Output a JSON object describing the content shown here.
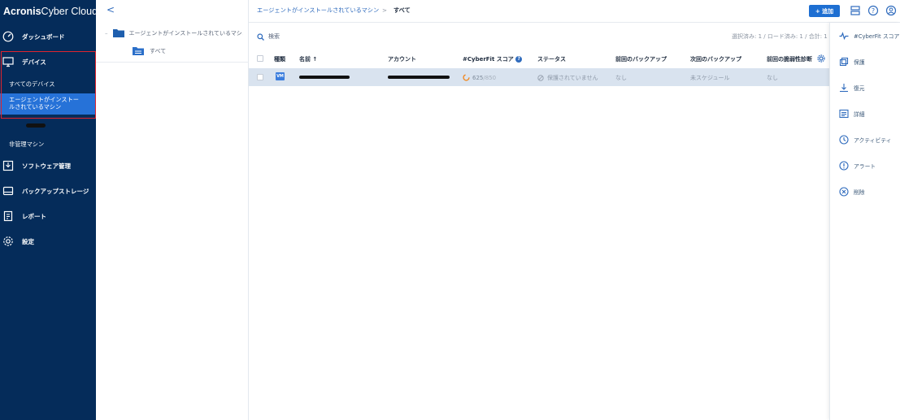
{
  "brand": {
    "name_bold": "Acronis",
    "name_rest": " Cyber Cloud"
  },
  "sidebar": {
    "items": [
      {
        "label": "ダッシュボード",
        "icon": "dashboard-icon"
      },
      {
        "label": "デバイス",
        "icon": "monitor-icon"
      },
      {
        "label": "ソフトウェア管理",
        "icon": "software-icon"
      },
      {
        "label": "バックアップストレージ",
        "icon": "storage-icon"
      },
      {
        "label": "レポート",
        "icon": "report-icon"
      },
      {
        "label": "設定",
        "icon": "gear-icon"
      }
    ],
    "sub_items": [
      {
        "label": "すべてのデバイス"
      },
      {
        "label_line1": "エージェントがインストー",
        "label_line2": "ルされているマシン"
      },
      {
        "label": "非管理マシン"
      }
    ]
  },
  "tree": {
    "back_glyph": "<",
    "root_label": "エージェントがインストールされているマシン",
    "child_label": "すべて"
  },
  "breadcrumb": {
    "parent": "エージェントがインストールされているマシン",
    "separator": ">",
    "current": "すべて"
  },
  "toolbar": {
    "add_label": "+ 追加"
  },
  "search": {
    "placeholder": "検索"
  },
  "count_text": "選択済み: 1 / ロード済み: 1 / 合計: 1",
  "table": {
    "columns": [
      "種類",
      "名前 ↑",
      "アカウント",
      "#CyberFit スコア",
      "ステータス",
      "前回のバックアップ",
      "次回のバックアップ",
      "前回の脆弱性診断"
    ],
    "row": {
      "type_badge": "VM",
      "score": "625",
      "score_max": "/850",
      "status": "保護されていません",
      "last_backup": "なし",
      "next_backup": "未スケジュール",
      "last_scan": "なし"
    }
  },
  "actions": [
    {
      "label": "#CyberFit スコア",
      "icon": "pulse-icon"
    },
    {
      "label": "保護",
      "icon": "protect-icon"
    },
    {
      "label": "復元",
      "icon": "recover-icon"
    },
    {
      "label": "詳細",
      "icon": "details-icon"
    },
    {
      "label": "アクティビティ",
      "icon": "clock-icon"
    },
    {
      "label": "アラート",
      "icon": "alert-icon"
    },
    {
      "label": "削除",
      "icon": "delete-icon"
    }
  ],
  "colors": {
    "sidebar": "#052c5a",
    "active": "#2672d8",
    "accent": "#1e6fd2",
    "highlight_border": "#e0242e",
    "row_selected": "#d9e3ef"
  }
}
